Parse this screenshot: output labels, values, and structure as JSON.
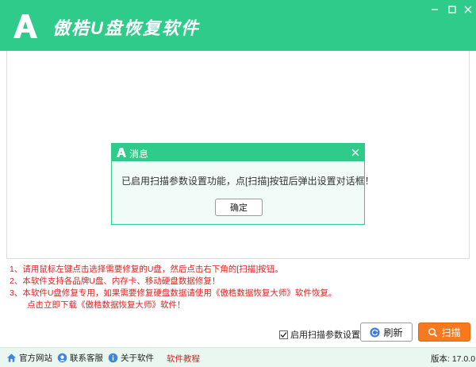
{
  "app": {
    "title": "傲梏U盘恢复软件",
    "brand_color": "#2ecb8a",
    "accent_color": "#f57a1f"
  },
  "window_controls": {
    "minimize_icon": "minimize-icon",
    "maximize_icon": "maximize-icon",
    "close_icon": "close-icon"
  },
  "dialog": {
    "title": "消息",
    "message": "已启用扫描参数设置功能，点[扫描]按钮后弹出设置对话框！",
    "ok_label": "确定"
  },
  "notes": [
    "1、请用鼠标左键点击选择需要修复的U盘，然后点击右下角的[扫描]按钮。",
    "2、本软件支持各品牌U盘、内存卡、移动硬盘数据修复！",
    "3、本软件U盘修复专用，如果需要修复硬盘数据请使用《傲梏数据恢复大师》软件恢复。",
    "点击立即下载《傲梏数据恢复大师》软件！"
  ],
  "actions": {
    "scan_params_label": "启用扫描参数设置",
    "scan_params_checked": true,
    "refresh_label": "刷新",
    "scan_label": "扫描"
  },
  "footer": {
    "website_label": "官方网站",
    "support_label": "联系客服",
    "about_label": "关于软件",
    "tutorial_label": "软件教程",
    "version_label": "版本: 17.0.0"
  }
}
